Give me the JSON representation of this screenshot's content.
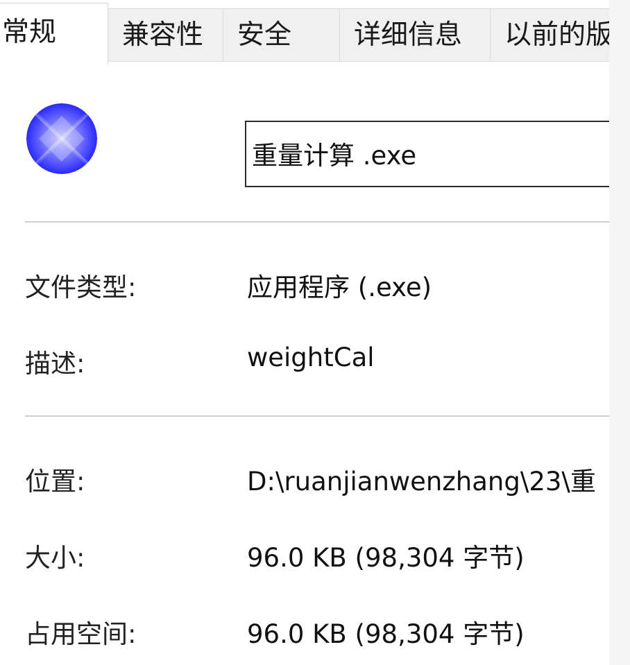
{
  "tabs": [
    {
      "label": "常规",
      "active": true
    },
    {
      "label": "兼容性",
      "active": false
    },
    {
      "label": "安全",
      "active": false
    },
    {
      "label": "详细信息",
      "active": false
    },
    {
      "label": "以前的版",
      "active": false
    }
  ],
  "file": {
    "icon": "blue-orb-app-icon",
    "name": "重量计算 .exe"
  },
  "properties": {
    "type_label": "文件类型:",
    "type_value": "应用程序 (.exe)",
    "desc_label": "描述:",
    "desc_value": "weightCal",
    "location_label": "位置:",
    "location_value": "D:\\ruanjianwenzhang\\23\\重",
    "size_label": "大小:",
    "size_value": "96.0 KB (98,304 字节)",
    "disk_label": "占用空间:",
    "disk_value": "96.0 KB (98,304 字节)"
  },
  "colors": {
    "icon_center": "#e6e6ff",
    "icon_edge": "#1a1aff",
    "tab_inactive_bg": "#f0f0f0",
    "divider": "#cfcfcf"
  }
}
